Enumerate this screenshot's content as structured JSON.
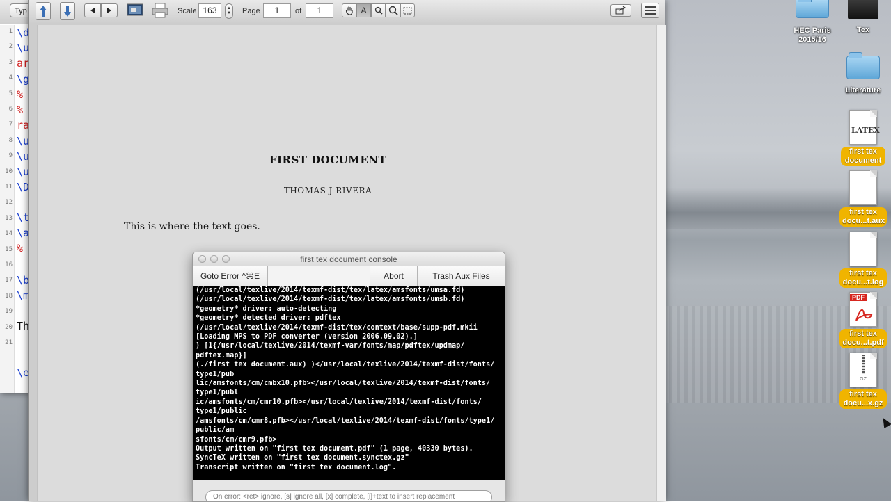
{
  "editor": {
    "toolbar_button": "Typ",
    "line_numbers": [
      "1",
      "2",
      "3",
      "4",
      "5",
      "6",
      "7",
      "8",
      "9",
      "10",
      "11",
      "12",
      "13",
      "14",
      "15",
      "16",
      "17",
      "18",
      "19",
      "20",
      "21"
    ],
    "code_fragments": [
      {
        "text": "\\d",
        "color": "#1a3fd1"
      },
      {
        "text": "\\u",
        "color": "#1a3fd1"
      },
      {
        "text": "ar",
        "color": "#d22020"
      },
      {
        "text": "\\g",
        "color": "#1a3fd1"
      },
      {
        "text": "%",
        "color": "#d22020"
      },
      {
        "text": "%",
        "color": "#d22020"
      },
      {
        "text": "ra",
        "color": "#d22020"
      },
      {
        "text": "\\u",
        "color": "#1a3fd1"
      },
      {
        "text": "\\u",
        "color": "#1a3fd1"
      },
      {
        "text": "\\u",
        "color": "#1a3fd1"
      },
      {
        "text": "\\D",
        "color": "#1a3fd1"
      },
      {
        "text": "\\ti",
        "color": "#1a3fd1"
      },
      {
        "text": "\\a",
        "color": "#1a3fd1"
      },
      {
        "text": "%",
        "color": "#d22020"
      },
      {
        "text": "\\b",
        "color": "#1a3fd1"
      },
      {
        "text": "\\m",
        "color": "#1a3fd1"
      },
      {
        "text": "Th",
        "color": "#111111"
      },
      {
        "text": "\\e",
        "color": "#1a3fd1"
      }
    ]
  },
  "toolbar": {
    "scale_label": "Scale",
    "scale_value": "163",
    "page_label": "Page",
    "page_value": "1",
    "of_label": "of",
    "page_total": "1",
    "text_tool_glyph": "A"
  },
  "document": {
    "title": "FIRST DOCUMENT",
    "author": "THOMAS J RIVERA",
    "body": "This is where the text goes."
  },
  "console": {
    "title": "first tex document console",
    "goto_error": "Goto Error ^⌘E",
    "abort": "Abort",
    "trash_aux": "Trash Aux Files",
    "log_lines": [
      "(/usr/local/texlive/2014/texmf-dist/tex/latex/amsfonts/umsa.fd)",
      "(/usr/local/texlive/2014/texmf-dist/tex/latex/amsfonts/umsb.fd)",
      "*geometry* driver: auto-detecting",
      "*geometry* detected driver: pdftex",
      "(/usr/local/texlive/2014/texmf-dist/tex/context/base/supp-pdf.mkii",
      "[Loading MPS to PDF converter (version 2006.09.02).]",
      ") [1{/usr/local/texlive/2014/texmf-var/fonts/map/pdftex/updmap/",
      "pdftex.map}]",
      "(./first tex document.aux) )</usr/local/texlive/2014/texmf-dist/fonts/",
      "type1/pub",
      "lic/amsfonts/cm/cmbx10.pfb></usr/local/texlive/2014/texmf-dist/fonts/",
      "type1/publ",
      "ic/amsfonts/cm/cmr10.pfb></usr/local/texlive/2014/texmf-dist/fonts/",
      "type1/public",
      "/amsfonts/cm/cmr8.pfb></usr/local/texlive/2014/texmf-dist/fonts/type1/",
      "public/am",
      "sfonts/cm/cmr9.pfb>",
      "Output written on \"first tex document.pdf\" (1 page, 40330 bytes).",
      "SyncTeX written on \"first tex document.synctex.gz\"",
      "Transcript written on \"first tex document.log\"."
    ],
    "input_placeholder": "On error: <ret> ignore, [s] ignore all, [x] complete, [i]+text to insert replacement"
  },
  "desktop": {
    "folder_hec": "HEC Paris 2015/16",
    "folder_tex": "Tex",
    "folder_literature": "Literature",
    "file_tex": "first tex document",
    "file_aux": "first tex docu...t.aux",
    "file_log": "first tex docu...t.log",
    "file_pdf": "first tex docu...t.pdf",
    "file_gz": "first tex docu...x.gz",
    "tex_icon_text": "LATEX",
    "pdf_icon_text": "PDF",
    "gz_icon_text": "GZ"
  }
}
